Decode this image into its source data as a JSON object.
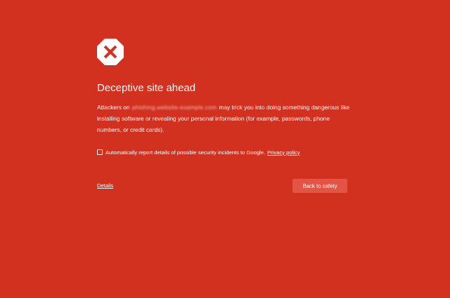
{
  "icons": {
    "warning": "close-x-octagon"
  },
  "colors": {
    "background": "#d2311f",
    "button": "#e45444",
    "icon_x": "#d2311f",
    "text": "#ffffff"
  },
  "interstitial": {
    "title": "Deceptive site ahead",
    "body_prefix": "Attackers on ",
    "blurred_domain": "phishing.website-example.com",
    "body_suffix": " may trick you into doing something dangerous like installing software or revealing your personal information (for example, passwords, phone numbers, or credit cards).",
    "report_label": "Automatically report details of possible security incidents to Google.",
    "privacy_link": "Privacy policy",
    "details_link": "Details",
    "safety_button": "Back to safety"
  }
}
